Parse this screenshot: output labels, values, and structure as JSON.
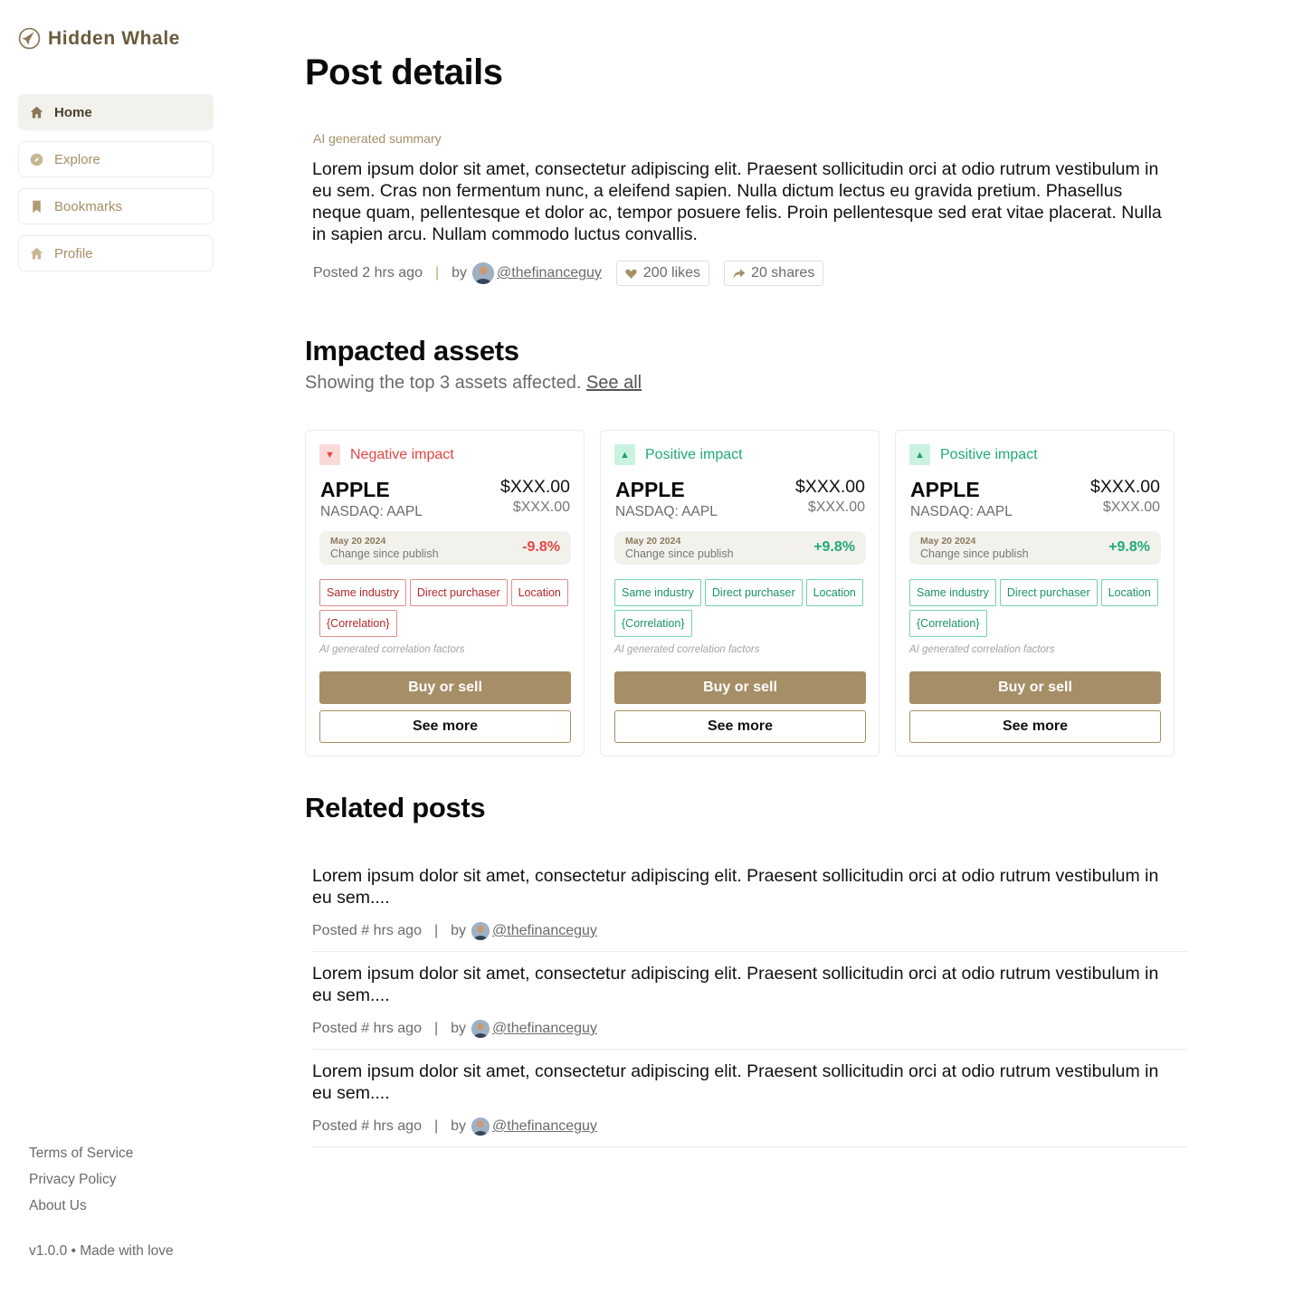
{
  "brand": {
    "name": "Hidden Whale"
  },
  "nav": [
    {
      "label": "Home",
      "icon": "home-icon",
      "active": true
    },
    {
      "label": "Explore",
      "icon": "compass-icon",
      "active": false
    },
    {
      "label": "Bookmarks",
      "icon": "bookmark-icon",
      "active": false
    },
    {
      "label": "Profile",
      "icon": "home-icon",
      "active": false
    }
  ],
  "footer": {
    "links": [
      "Terms of Service",
      "Privacy Policy",
      "About Us"
    ],
    "version": "v1.0.0 • Made with love"
  },
  "post": {
    "title": "Post details",
    "ai_label": "AI generated summary",
    "summary": "Lorem ipsum dolor sit amet, consectetur adipiscing elit. Praesent sollicitudin orci at odio rutrum vestibulum in eu sem. Cras non fermentum nunc, a eleifend sapien. Nulla dictum lectus eu gravida pretium. Phasellus neque quam, pellentesque et dolor ac, tempor posuere felis. Proin pellentesque sed erat vitae placerat. Nulla in sapien arcu. Nullam commodo luctus convallis.",
    "posted": "Posted 2 hrs ago",
    "separator": "|",
    "by": "by",
    "handle": "@thefinanceguy",
    "likes": "200 likes",
    "shares": "20 shares"
  },
  "assets": {
    "heading": "Impacted assets",
    "subtext": "Showing the top 3 assets affected.",
    "see_all": "See all",
    "cards": [
      {
        "impact": "Negative impact",
        "direction": "negative",
        "arrow": "▼",
        "ticker": "APPLE",
        "exchange": "NASDAQ: AAPL",
        "price": "$XXX.00",
        "price_secondary": "$XXX.00",
        "date": "May 20 2024",
        "change_label": "Change since publish",
        "change": "-9.8%",
        "tags": [
          "Same industry",
          "Direct purchaser",
          "Location",
          "{Correlation}"
        ],
        "factors_note": "AI generated correlation factors",
        "primary_button": "Buy or sell",
        "secondary_button": "See more"
      },
      {
        "impact": "Positive impact",
        "direction": "positive",
        "arrow": "▲",
        "ticker": "APPLE",
        "exchange": "NASDAQ: AAPL",
        "price": "$XXX.00",
        "price_secondary": "$XXX.00",
        "date": "May 20 2024",
        "change_label": "Change since publish",
        "change": "+9.8%",
        "tags": [
          "Same industry",
          "Direct purchaser",
          "Location",
          "{Correlation}"
        ],
        "factors_note": "AI generated correlation factors",
        "primary_button": "Buy or sell",
        "secondary_button": "See more"
      },
      {
        "impact": "Positive impact",
        "direction": "positive",
        "arrow": "▲",
        "ticker": "APPLE",
        "exchange": "NASDAQ: AAPL",
        "price": "$XXX.00",
        "price_secondary": "$XXX.00",
        "date": "May 20 2024",
        "change_label": "Change since publish",
        "change": "+9.8%",
        "tags": [
          "Same industry",
          "Direct purchaser",
          "Location",
          "{Correlation}"
        ],
        "factors_note": "AI generated correlation factors",
        "primary_button": "Buy or sell",
        "secondary_button": "See more"
      }
    ]
  },
  "related": {
    "heading": "Related posts",
    "posts": [
      {
        "text": "Lorem ipsum dolor sit amet, consectetur adipiscing elit. Praesent sollicitudin orci at odio rutrum vestibulum in eu sem....",
        "posted": "Posted # hrs ago",
        "separator": "|",
        "by": "by",
        "handle": "@thefinanceguy"
      },
      {
        "text": "Lorem ipsum dolor sit amet, consectetur adipiscing elit. Praesent sollicitudin orci at odio rutrum vestibulum in eu sem....",
        "posted": "Posted # hrs ago",
        "separator": "|",
        "by": "by",
        "handle": "@thefinanceguy"
      },
      {
        "text": "Lorem ipsum dolor sit amet, consectetur adipiscing elit. Praesent sollicitudin orci at odio rutrum vestibulum in eu sem....",
        "posted": "Posted # hrs ago",
        "separator": "|",
        "by": "by",
        "handle": "@thefinanceguy"
      }
    ]
  },
  "colors": {
    "accent": "#a68e66",
    "brand_text": "#6b5a3c",
    "negative": "#e24545",
    "positive": "#1faa77"
  }
}
